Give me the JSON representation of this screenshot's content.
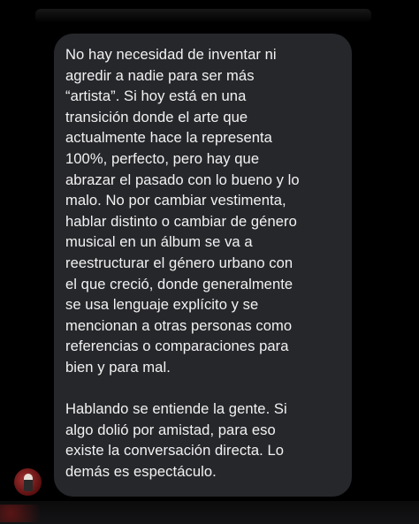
{
  "message": {
    "paragraphs": [
      "No hay necesidad de inventar ni\nagredir a nadie para ser más\n“artista”. Si hoy está en una\ntransición donde el arte que\nactualmente hace la representa\n100%, perfecto, pero hay que\nabrazar el pasado con lo bueno y lo\nmalo. No por cambiar vestimenta,\nhablar distinto o cambiar de género\nmusical en un álbum se va a\nreestructurar el género urbano con\nel que creció, donde generalmente\nse usa lenguaje explícito y se\nmencionan a otras personas como\nreferencias o comparaciones para\nbien y para mal.",
      "Hablando se entiende la gente. Si\nalgo dolió por amistad, para eso\nexiste la conversación directa. Lo\ndemás es espectáculo."
    ]
  },
  "colors": {
    "background": "#000000",
    "bubble": "#26272b",
    "text": "#f2f2f2",
    "avatar_accent": "#a33232"
  }
}
